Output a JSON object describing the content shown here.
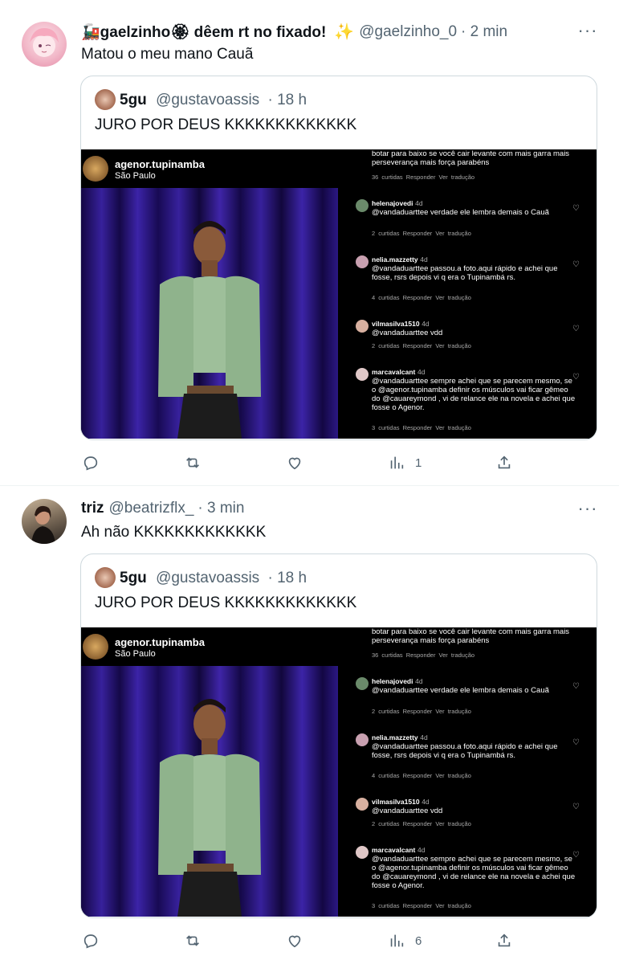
{
  "tweets": [
    {
      "name": "🚂gaelzinho🏵 dêem rt no fixado!",
      "sparkle": "✨",
      "handle": "@gaelzinho_0",
      "time": "· 2 min",
      "text": "Matou o meu mano Cauã",
      "views": "1",
      "quote": {
        "name": "5gu",
        "handle": "@gustavoassis",
        "time": "· 18 h",
        "text": "JURO POR DEUS KKKKKKKKKKKKK"
      }
    },
    {
      "name": "triz",
      "handle": "@beatrizflx_",
      "time": "· 3 min",
      "text": "Ah não KKKKKKKKKKKKK",
      "views": "6",
      "quote": {
        "name": "5gu",
        "handle": "@gustavoassis",
        "time": "· 18 h",
        "text": "JURO POR DEUS KKKKKKKKKKKKK"
      }
    }
  ],
  "instagram": {
    "user": "agenor.tupinamba",
    "location": "São Paulo",
    "top_comment": "botar para baixo se você cair levante com mais garra mais perseverança mais força parabéns",
    "top_meta": "36 curtidas   Responder   Ver tradução",
    "comments": [
      {
        "user": "helenajovedi",
        "time": "4d",
        "text": "@vandaduarttee verdade ele lembra demais o Cauã",
        "meta": "2 curtidas   Responder   Ver tradução"
      },
      {
        "user": "nelia.mazzetty",
        "time": "4d",
        "text": "@vandaduarttee passou.a foto.aqui rápido e achei que  fosse, rsrs depois vi q era o Tupinambá rs.",
        "meta": "4 curtidas   Responder   Ver tradução"
      },
      {
        "user": "vilmasilva1510",
        "time": "4d",
        "text": "@vandaduarttee vdd",
        "meta": "2 curtidas   Responder   Ver tradução"
      },
      {
        "user": "marcavalcant",
        "time": "4d",
        "text": "@vandaduarttee sempre achei que se parecem mesmo, se o @agenor.tupinamba definir os músculos vai ficar gêmeo do @cauareymond , vi de relance ele na novela e achei que fosse o Agenor.",
        "meta": "3 curtidas   Responder   Ver tradução"
      }
    ]
  },
  "colors": {
    "text": "#0f1419",
    "secondary": "#536471",
    "border": "#cfd9de"
  }
}
